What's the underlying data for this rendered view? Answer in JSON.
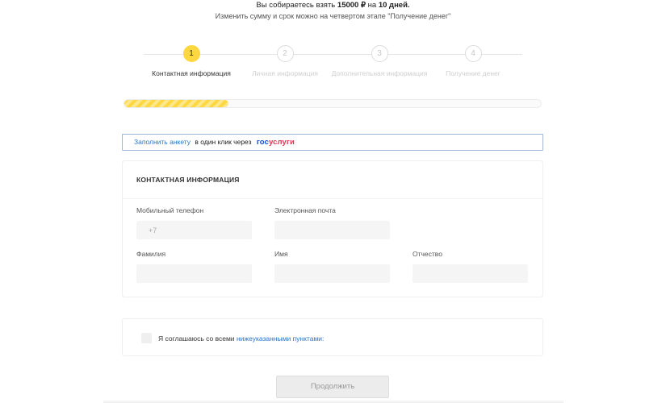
{
  "header": {
    "prefix": "Вы собираетесь взять",
    "amount": "15000 ₽",
    "on": "на",
    "term": "10 дней.",
    "subtitle": "Изменить сумму и срок можно на четвертом этапе \"Получение денег\""
  },
  "steps": [
    {
      "number": "1",
      "label": "Контактная информация",
      "active": true
    },
    {
      "number": "2",
      "label": "Личная информация",
      "active": false
    },
    {
      "number": "3",
      "label": "Дополнительная информация",
      "active": false
    },
    {
      "number": "4",
      "label": "Получение денег",
      "active": false
    }
  ],
  "progress": {
    "fraction": 0.25
  },
  "gosuslugi": {
    "link": "Заполнить анкету",
    "text": "в один клик через",
    "logo_a": "гос",
    "logo_b": "услуги"
  },
  "contact": {
    "title": "КОНТАКТНАЯ ИНФОРМАЦИЯ",
    "phone_label": "Мобильный телефон",
    "phone_placeholder": "+7",
    "email_label": "Электронная почта",
    "lastname_label": "Фамилия",
    "firstname_label": "Имя",
    "middlename_label": "Отчество"
  },
  "agreement": {
    "text": "Я соглашаюсь со всеми",
    "link": "нижеуказанными пунктами:"
  },
  "submit": {
    "label": "Продолжить"
  },
  "colors": {
    "accent": "#ffd740",
    "link": "#2c74c9",
    "gos_blue": "#0d4cd3",
    "gos_red": "#ee2f53"
  }
}
